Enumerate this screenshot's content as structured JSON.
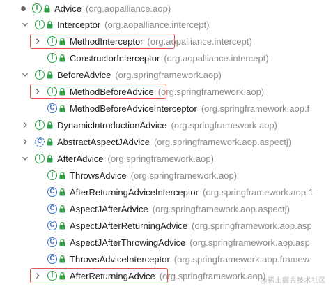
{
  "tree": [
    {
      "name": "Advice",
      "package": "(org.aopalliance.aop)",
      "kind": "interface",
      "toggle": "dot"
    },
    {
      "name": "Interceptor",
      "package": "(org.aopalliance.intercept)",
      "kind": "interface",
      "toggle": "expanded"
    },
    {
      "name": "MethodInterceptor",
      "package": "(org.aopalliance.intercept)",
      "kind": "interface",
      "toggle": "collapsed",
      "highlighted": true
    },
    {
      "name": "ConstructorInterceptor",
      "package": "(org.aopalliance.intercept)",
      "kind": "interface",
      "toggle": "none"
    },
    {
      "name": "BeforeAdvice",
      "package": "(org.springframework.aop)",
      "kind": "interface",
      "toggle": "expanded"
    },
    {
      "name": "MethodBeforeAdvice",
      "package": "(org.springframework.aop)",
      "kind": "interface",
      "toggle": "collapsed",
      "highlighted": true
    },
    {
      "name": "MethodBeforeAdviceInterceptor",
      "package": "(org.springframework.aop.f",
      "kind": "class",
      "toggle": "none"
    },
    {
      "name": "DynamicIntroductionAdvice",
      "package": "(org.springframework.aop)",
      "kind": "interface",
      "toggle": "collapsed"
    },
    {
      "name": "AbstractAspectJAdvice",
      "package": "(org.springframework.aop.aspectj)",
      "kind": "abstract",
      "toggle": "collapsed"
    },
    {
      "name": "AfterAdvice",
      "package": "(org.springframework.aop)",
      "kind": "interface",
      "toggle": "expanded"
    },
    {
      "name": "ThrowsAdvice",
      "package": "(org.springframework.aop)",
      "kind": "interface",
      "toggle": "none"
    },
    {
      "name": "AfterReturningAdviceInterceptor",
      "package": "(org.springframework.aop.1",
      "kind": "class",
      "toggle": "none"
    },
    {
      "name": "AspectJAfterAdvice",
      "package": "(org.springframework.aop.aspectj)",
      "kind": "class",
      "toggle": "none"
    },
    {
      "name": "AspectJAfterReturningAdvice",
      "package": "(org.springframework.aop.asp",
      "kind": "class",
      "toggle": "none"
    },
    {
      "name": "AspectJAfterThrowingAdvice",
      "package": "(org.springframework.aop.asp",
      "kind": "class",
      "toggle": "none"
    },
    {
      "name": "ThrowsAdviceInterceptor",
      "package": "(org.springframework.aop.framew",
      "kind": "class",
      "toggle": "none"
    },
    {
      "name": "AfterReturningAdvice",
      "package": "(org.springframework.aop)",
      "kind": "interface",
      "toggle": "collapsed",
      "highlighted": true
    }
  ],
  "icons": {
    "interface_letter": "I",
    "class_letter": "C",
    "interface_color": "#2f9e44",
    "class_color": "#3a73c4",
    "highlight_color": "#e2554a"
  },
  "watermark": "@稀土掘金技术社区"
}
